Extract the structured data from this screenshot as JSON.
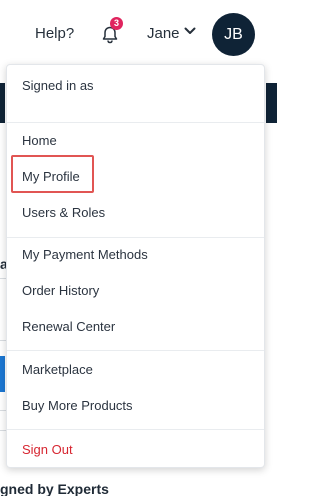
{
  "header": {
    "help_label": "Help?",
    "notification_count": "3",
    "username": "Jane",
    "avatar_initials": "JB"
  },
  "menu": {
    "signed_in_label": "Signed in as",
    "items": [
      {
        "label": "Home"
      },
      {
        "label": "My Profile"
      },
      {
        "label": "Users & Roles"
      },
      {
        "label": "My Payment Methods"
      },
      {
        "label": "Order History"
      },
      {
        "label": "Renewal Center"
      },
      {
        "label": "Marketplace"
      },
      {
        "label": "Buy More Products"
      },
      {
        "label": "Sign Out"
      }
    ]
  },
  "background": {
    "partial_heading": "gned by Experts",
    "partial_char": "a"
  },
  "colors": {
    "avatar_bg": "#0f2336",
    "badge_bg": "#e0245e",
    "sign_out": "#d72631",
    "highlight_border": "#e15553"
  }
}
